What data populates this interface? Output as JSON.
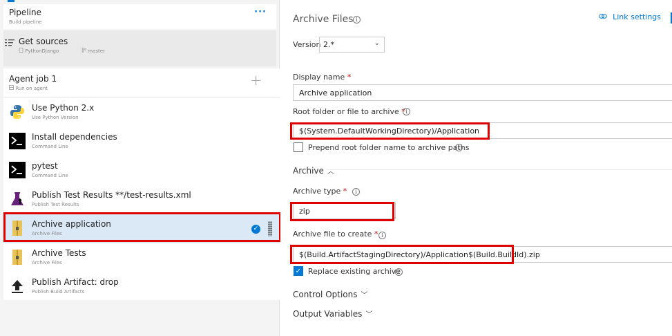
{
  "pipeline": {
    "title": "Pipeline",
    "subtitle": "Build pipeline",
    "more": "···"
  },
  "get_sources": {
    "title": "Get sources",
    "repo": "PythonDjango",
    "branch": "master"
  },
  "agent_job": {
    "title": "Agent job 1",
    "subtitle": "Run on agent",
    "add": "+"
  },
  "tasks": [
    {
      "title": "Use Python 2.x",
      "subtitle": "Use Python Version",
      "icon": "python-icon"
    },
    {
      "title": "Install dependencies",
      "subtitle": "Command Line",
      "icon": "command-line-icon"
    },
    {
      "title": "pytest",
      "subtitle": "Command Line",
      "icon": "command-line-icon"
    },
    {
      "title": "Publish Test Results **/test-results.xml",
      "subtitle": "Publish Test Results",
      "icon": "flask-icon"
    },
    {
      "title": "Archive application",
      "subtitle": "Archive Files",
      "icon": "archive-icon",
      "selected": true
    },
    {
      "title": "Archive Tests",
      "subtitle": "Archive Files",
      "icon": "archive-icon"
    },
    {
      "title": "Publish Artifact: drop",
      "subtitle": "Publish Build Artifacts",
      "icon": "upload-icon"
    }
  ],
  "detail": {
    "title": "Archive Files",
    "link_settings": "Link settings",
    "version_label": "Version",
    "version_value": "2.*",
    "display_name_label": "Display name",
    "display_name_value": "Archive application",
    "root_folder_label": "Root folder or file to archive",
    "root_folder_value": "$(System.DefaultWorkingDirectory)/Application",
    "prepend_label": "Prepend root folder name to archive paths",
    "archive_section": "Archive",
    "archive_type_label": "Archive type",
    "archive_type_value": "zip",
    "archive_file_label": "Archive file to create",
    "archive_file_value": "$(Build.ArtifactStagingDirectory)/Application$(Build.BuildId).zip",
    "replace_label": "Replace existing archive",
    "control_options": "Control Options",
    "output_variables": "Output Variables",
    "required_mark": "*"
  },
  "colors": {
    "accent": "#0078d4",
    "highlight": "#e00000",
    "selected_bg": "#dbe9f7"
  }
}
